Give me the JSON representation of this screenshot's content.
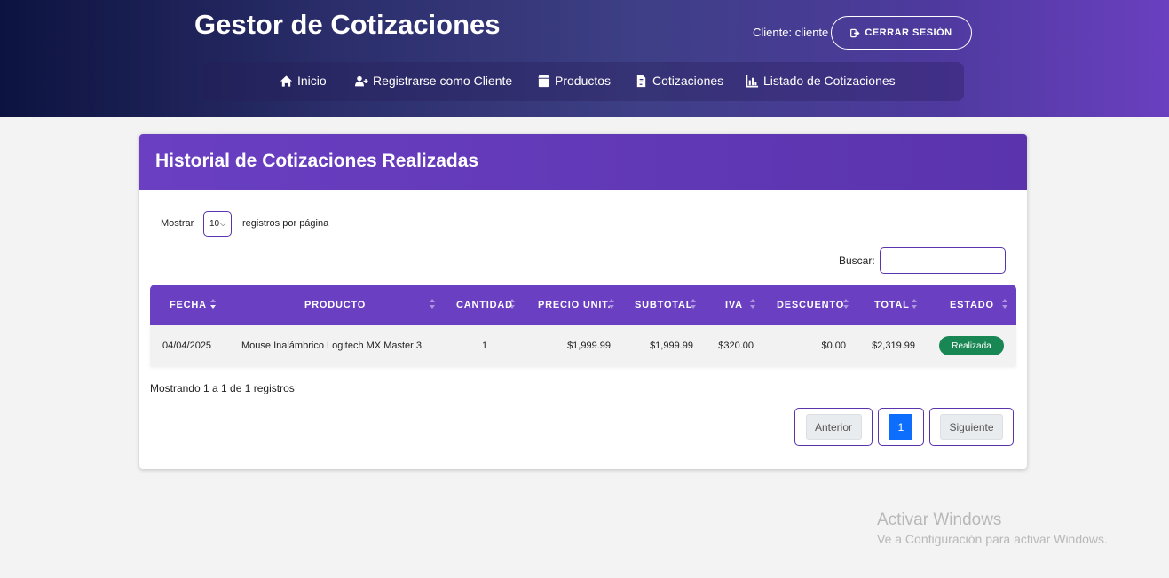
{
  "app": {
    "title": "Gestor de Cotizaciones",
    "client_label": "Cliente: cliente",
    "logout_label": "CERRAR SESIÓN"
  },
  "nav": {
    "items": [
      {
        "label": "Inicio",
        "icon": "home-icon"
      },
      {
        "label": "Registrarse como Cliente",
        "icon": "user-plus-icon"
      },
      {
        "label": "Productos",
        "icon": "box-icon"
      },
      {
        "label": "Cotizaciones",
        "icon": "file-invoice-icon"
      },
      {
        "label": "Listado de Cotizaciones",
        "icon": "chart-icon"
      }
    ]
  },
  "card": {
    "title": "Historial de Cotizaciones Realizadas"
  },
  "controls": {
    "show_label": "Mostrar",
    "page_length": "10",
    "per_page_label": "registros por página",
    "search_label": "Buscar:",
    "search_value": ""
  },
  "table": {
    "columns": [
      "Fecha",
      "Producto",
      "Cantidad",
      "Precio Unit.",
      "Subtotal",
      "IVA",
      "Descuento",
      "Total",
      "Estado"
    ],
    "sorted_column": "Fecha",
    "rows": [
      {
        "fecha": "04/04/2025",
        "producto": "Mouse Inalámbrico Logitech MX Master 3",
        "cantidad": "1",
        "precio_unit": "$1,999.99",
        "subtotal": "$1,999.99",
        "iva": "$320.00",
        "descuento": "$0.00",
        "total": "$2,319.99",
        "estado": "Realizada"
      }
    ]
  },
  "footer": {
    "info": "Mostrando 1 a 1 de 1 registros"
  },
  "pagination": {
    "previous": "Anterior",
    "current": "1",
    "next": "Siguiente"
  },
  "windows_watermark": {
    "title": "Activar Windows",
    "subtitle": "Ve a Configuración para activar Windows."
  },
  "colors": {
    "primary": "#6a3fc2",
    "header_dark": "#0d1340",
    "success": "#198754",
    "page_active": "#0d6efd"
  }
}
